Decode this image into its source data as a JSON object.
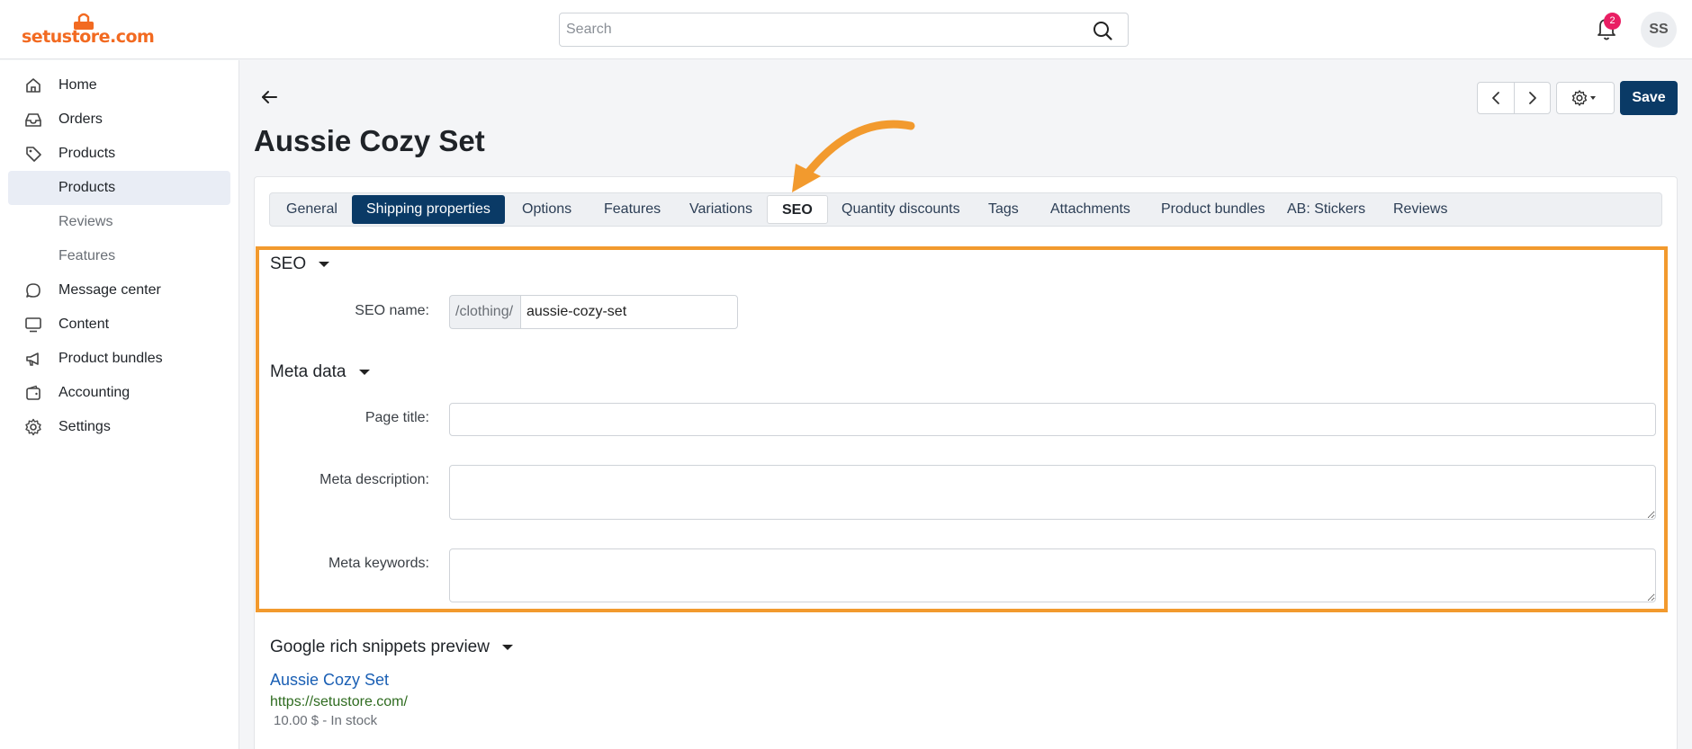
{
  "brand": {
    "logo_text": "setustore.com",
    "accent": "#f26a21",
    "primary": "#0a3a66",
    "highlight": "#f29a2e"
  },
  "topbar": {
    "search_placeholder": "Search",
    "notifications_count": "2",
    "avatar_initials": "SS"
  },
  "sidebar": {
    "items": [
      {
        "label": "Home",
        "icon": "home-icon"
      },
      {
        "label": "Orders",
        "icon": "inbox-icon"
      },
      {
        "label": "Products",
        "icon": "tag-icon"
      },
      {
        "label": "Products",
        "icon": ""
      },
      {
        "label": "Reviews",
        "icon": ""
      },
      {
        "label": "Features",
        "icon": ""
      },
      {
        "label": "Message center",
        "icon": "chat-icon"
      },
      {
        "label": "Content",
        "icon": "monitor-icon"
      },
      {
        "label": "Product bundles",
        "icon": "megaphone-icon"
      },
      {
        "label": "Accounting",
        "icon": "wallet-icon"
      },
      {
        "label": "Settings",
        "icon": "gear-icon"
      }
    ]
  },
  "header": {
    "title": "Aussie Cozy Set",
    "save_label": "Save"
  },
  "tabs": [
    "General",
    "Shipping properties",
    "Options",
    "Features",
    "Variations",
    "SEO",
    "Quantity discounts",
    "Tags",
    "Attachments",
    "Product bundles",
    "AB: Stickers",
    "Reviews"
  ],
  "seo": {
    "heading": "SEO",
    "name_label": "SEO name:",
    "name_prefix": "/clothing/",
    "name_value": "aussie-cozy-set"
  },
  "meta": {
    "heading": "Meta data",
    "page_title_label": "Page title:",
    "page_title_value": "",
    "description_label": "Meta description:",
    "description_value": "",
    "keywords_label": "Meta keywords:",
    "keywords_value": ""
  },
  "snippet": {
    "heading": "Google rich snippets preview",
    "title": "Aussie Cozy Set",
    "url": "https://setustore.com/",
    "meta": "10.00 $ - In stock"
  }
}
